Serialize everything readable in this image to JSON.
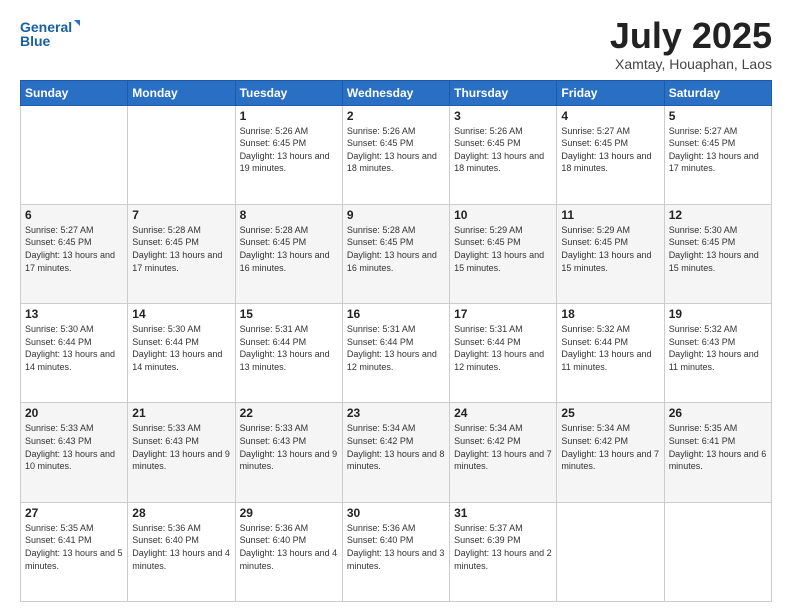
{
  "header": {
    "logo_line1": "General",
    "logo_line2": "Blue",
    "month": "July 2025",
    "location": "Xamtay, Houaphan, Laos"
  },
  "days_of_week": [
    "Sunday",
    "Monday",
    "Tuesday",
    "Wednesday",
    "Thursday",
    "Friday",
    "Saturday"
  ],
  "weeks": [
    [
      {
        "day": "",
        "info": ""
      },
      {
        "day": "",
        "info": ""
      },
      {
        "day": "1",
        "info": "Sunrise: 5:26 AM\nSunset: 6:45 PM\nDaylight: 13 hours and 19 minutes."
      },
      {
        "day": "2",
        "info": "Sunrise: 5:26 AM\nSunset: 6:45 PM\nDaylight: 13 hours and 18 minutes."
      },
      {
        "day": "3",
        "info": "Sunrise: 5:26 AM\nSunset: 6:45 PM\nDaylight: 13 hours and 18 minutes."
      },
      {
        "day": "4",
        "info": "Sunrise: 5:27 AM\nSunset: 6:45 PM\nDaylight: 13 hours and 18 minutes."
      },
      {
        "day": "5",
        "info": "Sunrise: 5:27 AM\nSunset: 6:45 PM\nDaylight: 13 hours and 17 minutes."
      }
    ],
    [
      {
        "day": "6",
        "info": "Sunrise: 5:27 AM\nSunset: 6:45 PM\nDaylight: 13 hours and 17 minutes."
      },
      {
        "day": "7",
        "info": "Sunrise: 5:28 AM\nSunset: 6:45 PM\nDaylight: 13 hours and 17 minutes."
      },
      {
        "day": "8",
        "info": "Sunrise: 5:28 AM\nSunset: 6:45 PM\nDaylight: 13 hours and 16 minutes."
      },
      {
        "day": "9",
        "info": "Sunrise: 5:28 AM\nSunset: 6:45 PM\nDaylight: 13 hours and 16 minutes."
      },
      {
        "day": "10",
        "info": "Sunrise: 5:29 AM\nSunset: 6:45 PM\nDaylight: 13 hours and 15 minutes."
      },
      {
        "day": "11",
        "info": "Sunrise: 5:29 AM\nSunset: 6:45 PM\nDaylight: 13 hours and 15 minutes."
      },
      {
        "day": "12",
        "info": "Sunrise: 5:30 AM\nSunset: 6:45 PM\nDaylight: 13 hours and 15 minutes."
      }
    ],
    [
      {
        "day": "13",
        "info": "Sunrise: 5:30 AM\nSunset: 6:44 PM\nDaylight: 13 hours and 14 minutes."
      },
      {
        "day": "14",
        "info": "Sunrise: 5:30 AM\nSunset: 6:44 PM\nDaylight: 13 hours and 14 minutes."
      },
      {
        "day": "15",
        "info": "Sunrise: 5:31 AM\nSunset: 6:44 PM\nDaylight: 13 hours and 13 minutes."
      },
      {
        "day": "16",
        "info": "Sunrise: 5:31 AM\nSunset: 6:44 PM\nDaylight: 13 hours and 12 minutes."
      },
      {
        "day": "17",
        "info": "Sunrise: 5:31 AM\nSunset: 6:44 PM\nDaylight: 13 hours and 12 minutes."
      },
      {
        "day": "18",
        "info": "Sunrise: 5:32 AM\nSunset: 6:44 PM\nDaylight: 13 hours and 11 minutes."
      },
      {
        "day": "19",
        "info": "Sunrise: 5:32 AM\nSunset: 6:43 PM\nDaylight: 13 hours and 11 minutes."
      }
    ],
    [
      {
        "day": "20",
        "info": "Sunrise: 5:33 AM\nSunset: 6:43 PM\nDaylight: 13 hours and 10 minutes."
      },
      {
        "day": "21",
        "info": "Sunrise: 5:33 AM\nSunset: 6:43 PM\nDaylight: 13 hours and 9 minutes."
      },
      {
        "day": "22",
        "info": "Sunrise: 5:33 AM\nSunset: 6:43 PM\nDaylight: 13 hours and 9 minutes."
      },
      {
        "day": "23",
        "info": "Sunrise: 5:34 AM\nSunset: 6:42 PM\nDaylight: 13 hours and 8 minutes."
      },
      {
        "day": "24",
        "info": "Sunrise: 5:34 AM\nSunset: 6:42 PM\nDaylight: 13 hours and 7 minutes."
      },
      {
        "day": "25",
        "info": "Sunrise: 5:34 AM\nSunset: 6:42 PM\nDaylight: 13 hours and 7 minutes."
      },
      {
        "day": "26",
        "info": "Sunrise: 5:35 AM\nSunset: 6:41 PM\nDaylight: 13 hours and 6 minutes."
      }
    ],
    [
      {
        "day": "27",
        "info": "Sunrise: 5:35 AM\nSunset: 6:41 PM\nDaylight: 13 hours and 5 minutes."
      },
      {
        "day": "28",
        "info": "Sunrise: 5:36 AM\nSunset: 6:40 PM\nDaylight: 13 hours and 4 minutes."
      },
      {
        "day": "29",
        "info": "Sunrise: 5:36 AM\nSunset: 6:40 PM\nDaylight: 13 hours and 4 minutes."
      },
      {
        "day": "30",
        "info": "Sunrise: 5:36 AM\nSunset: 6:40 PM\nDaylight: 13 hours and 3 minutes."
      },
      {
        "day": "31",
        "info": "Sunrise: 5:37 AM\nSunset: 6:39 PM\nDaylight: 13 hours and 2 minutes."
      },
      {
        "day": "",
        "info": ""
      },
      {
        "day": "",
        "info": ""
      }
    ]
  ]
}
